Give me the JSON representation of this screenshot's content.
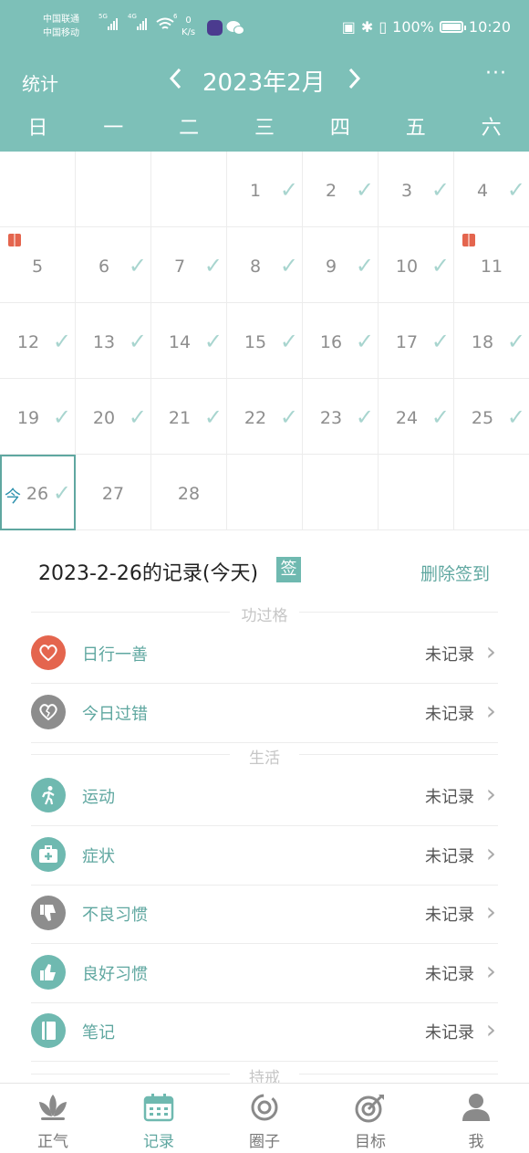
{
  "status_bar": {
    "carrier1": "中国联通",
    "carrier2": "中国移动",
    "sig1": "5G",
    "sig2": "4G",
    "sig3": "6",
    "net_speed_value": "0",
    "net_speed_unit": "K/s",
    "battery": "100%",
    "time": "10:20"
  },
  "header": {
    "left_label": "统计",
    "month": "2023年2月",
    "prev_icon": "chevron-left-icon",
    "next_icon": "chevron-right-icon",
    "more_icon": "more-icon",
    "more_glyph": "···"
  },
  "weekdays": [
    "日",
    "一",
    "二",
    "三",
    "四",
    "五",
    "六"
  ],
  "calendar": {
    "days": [
      {
        "day": ""
      },
      {
        "day": ""
      },
      {
        "day": ""
      },
      {
        "day": "1",
        "check": true
      },
      {
        "day": "2",
        "check": true
      },
      {
        "day": "3",
        "check": true
      },
      {
        "day": "4",
        "check": true
      },
      {
        "day": "5",
        "gift": true
      },
      {
        "day": "6",
        "check": true
      },
      {
        "day": "7",
        "check": true
      },
      {
        "day": "8",
        "check": true
      },
      {
        "day": "9",
        "check": true
      },
      {
        "day": "10",
        "check": true
      },
      {
        "day": "11",
        "gift": true
      },
      {
        "day": "12",
        "check": true
      },
      {
        "day": "13",
        "check": true
      },
      {
        "day": "14",
        "check": true
      },
      {
        "day": "15",
        "check": true
      },
      {
        "day": "16",
        "check": true
      },
      {
        "day": "17",
        "check": true
      },
      {
        "day": "18",
        "check": true
      },
      {
        "day": "19",
        "check": true
      },
      {
        "day": "20",
        "check": true
      },
      {
        "day": "21",
        "check": true
      },
      {
        "day": "22",
        "check": true
      },
      {
        "day": "23",
        "check": true
      },
      {
        "day": "24",
        "check": true
      },
      {
        "day": "25",
        "check": true
      },
      {
        "day": "26",
        "check": true,
        "today": true
      },
      {
        "day": "27"
      },
      {
        "day": "28"
      },
      {
        "day": ""
      },
      {
        "day": ""
      },
      {
        "day": ""
      },
      {
        "day": ""
      }
    ],
    "today_tag": "今",
    "check_glyph": "✓"
  },
  "record": {
    "title": "2023-2-26的记录(今天)",
    "sign_badge": "签",
    "delete_label": "删除签到"
  },
  "sections": [
    {
      "title": "功过格",
      "items": [
        {
          "label": "日行一善",
          "status": "未记录",
          "icon": "heart-icon",
          "color": "#e4654e"
        },
        {
          "label": "今日过错",
          "status": "未记录",
          "icon": "broken-heart-icon",
          "color": "#8d8d8d"
        }
      ]
    },
    {
      "title": "生活",
      "items": [
        {
          "label": "运动",
          "status": "未记录",
          "icon": "running-icon",
          "color": "#6fb9b0"
        },
        {
          "label": "症状",
          "status": "未记录",
          "icon": "medical-kit-icon",
          "color": "#6fb9b0"
        },
        {
          "label": "不良习惯",
          "status": "未记录",
          "icon": "thumbs-down-icon",
          "color": "#8d8d8d"
        },
        {
          "label": "良好习惯",
          "status": "未记录",
          "icon": "thumbs-up-icon",
          "color": "#6fb9b0"
        },
        {
          "label": "笔记",
          "status": "未记录",
          "icon": "notebook-icon",
          "color": "#6fb9b0"
        }
      ]
    },
    {
      "title": "持戒",
      "items": []
    }
  ],
  "chevron_glyph": "›",
  "tabs": [
    {
      "label": "正气",
      "icon": "lotus-icon"
    },
    {
      "label": "记录",
      "icon": "calendar-icon",
      "active": true
    },
    {
      "label": "圈子",
      "icon": "circle-icon"
    },
    {
      "label": "目标",
      "icon": "target-icon"
    },
    {
      "label": "我",
      "icon": "person-icon"
    }
  ],
  "colors": {
    "accent": "#7dc0b8",
    "accent_dark": "#5fa7a0",
    "check": "#a8d5cf",
    "today_text": "#2d91ad"
  }
}
